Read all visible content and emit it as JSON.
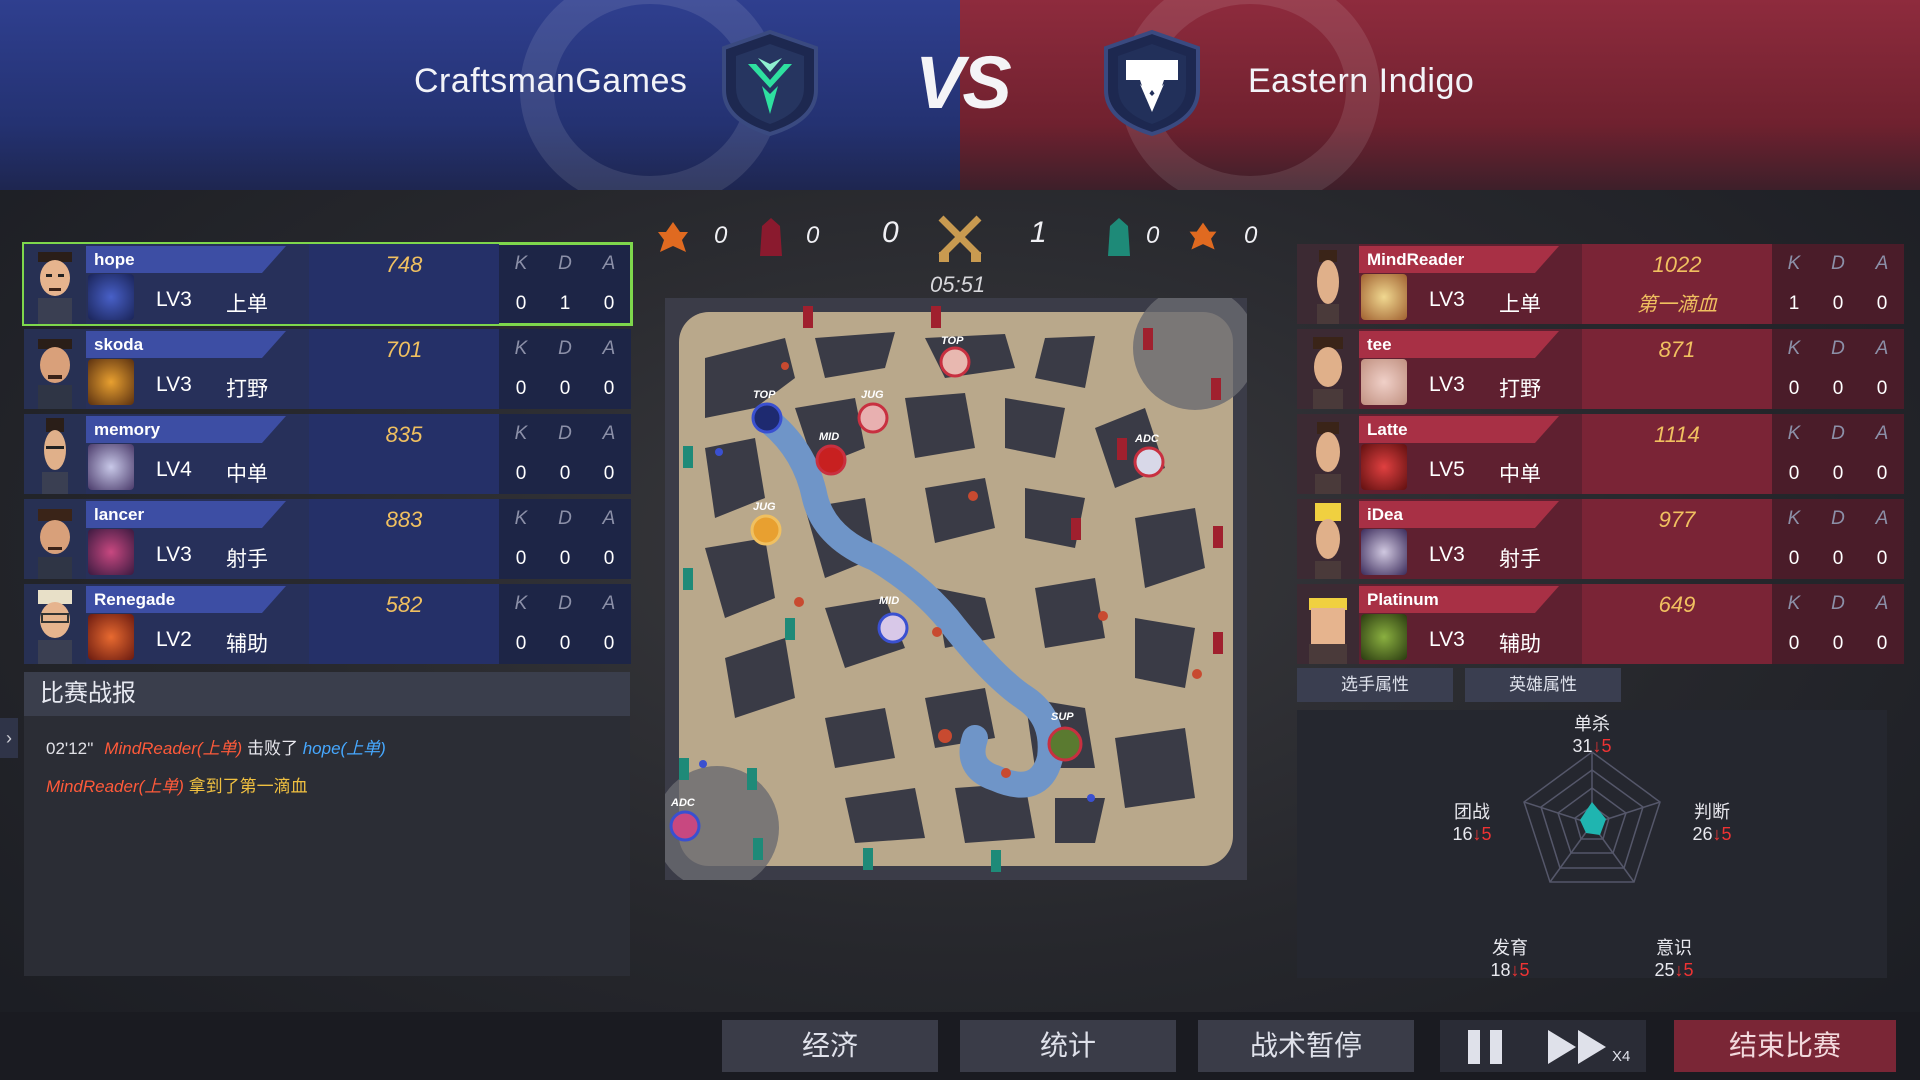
{
  "header": {
    "team_left": "CraftsmanGames",
    "team_right": "Eastern Indigo",
    "vs": "VS"
  },
  "score": {
    "left_tower": "0",
    "left_inhib": "0",
    "left_kills": "0",
    "right_kills": "1",
    "right_inhib": "0",
    "right_tower": "0",
    "timer": "05:51"
  },
  "kda_headers": {
    "k": "K",
    "d": "D",
    "a": "A"
  },
  "blue_players": [
    {
      "name": "hope",
      "level": "LV3",
      "role": "上单",
      "gold": "748",
      "k": "0",
      "d": "1",
      "a": "0"
    },
    {
      "name": "skoda",
      "level": "LV3",
      "role": "打野",
      "gold": "701",
      "k": "0",
      "d": "0",
      "a": "0"
    },
    {
      "name": "memory",
      "level": "LV4",
      "role": "中单",
      "gold": "835",
      "k": "0",
      "d": "0",
      "a": "0"
    },
    {
      "name": "lancer",
      "level": "LV3",
      "role": "射手",
      "gold": "883",
      "k": "0",
      "d": "0",
      "a": "0"
    },
    {
      "name": "Renegade",
      "level": "LV2",
      "role": "辅助",
      "gold": "582",
      "k": "0",
      "d": "0",
      "a": "0"
    }
  ],
  "red_players": [
    {
      "name": "MindReader",
      "level": "LV3",
      "role": "上单",
      "gold": "1022",
      "badge": "第一滴血",
      "k": "1",
      "d": "0",
      "a": "0"
    },
    {
      "name": "tee",
      "level": "LV3",
      "role": "打野",
      "gold": "871",
      "k": "0",
      "d": "0",
      "a": "0"
    },
    {
      "name": "Latte",
      "level": "LV5",
      "role": "中单",
      "gold": "1114",
      "k": "0",
      "d": "0",
      "a": "0"
    },
    {
      "name": "iDea",
      "level": "LV3",
      "role": "射手",
      "gold": "977",
      "k": "0",
      "d": "0",
      "a": "0"
    },
    {
      "name": "Platinum",
      "level": "LV3",
      "role": "辅助",
      "gold": "649",
      "k": "0",
      "d": "0",
      "a": "0"
    }
  ],
  "report": {
    "title": "比赛战报",
    "line1_time": "02'12''",
    "line1_killer": "MindReader(上单)",
    "line1_verb": "击败了",
    "line1_victim": "hope(上单)",
    "line2_actor": "MindReader(上单)",
    "line2_text": "拿到了第一滴血"
  },
  "map_labels": {
    "top": "TOP",
    "jug": "JUG",
    "mid": "MID",
    "adc": "ADC",
    "sup": "SUP"
  },
  "tabs": {
    "player_attr": "选手属性",
    "hero_attr": "英雄属性"
  },
  "radar": {
    "solo_kill": {
      "label": "单杀",
      "value": "31",
      "delta": "↓5"
    },
    "judgement": {
      "label": "判断",
      "value": "26",
      "delta": "↓5"
    },
    "awareness": {
      "label": "意识",
      "value": "25",
      "delta": "↓5"
    },
    "farming": {
      "label": "发育",
      "value": "18",
      "delta": "↓5"
    },
    "teamfight": {
      "label": "团战",
      "value": "16",
      "delta": "↓5"
    }
  },
  "bottom": {
    "economy": "经济",
    "stats": "统计",
    "tactical_pause": "战术暂停",
    "speed": "X4",
    "end_match": "结束比赛"
  },
  "colors": {
    "blue_team": "#3d4ea4",
    "red_team": "#a83045",
    "selected": "#7ed74c",
    "gold": "#f0c060"
  }
}
